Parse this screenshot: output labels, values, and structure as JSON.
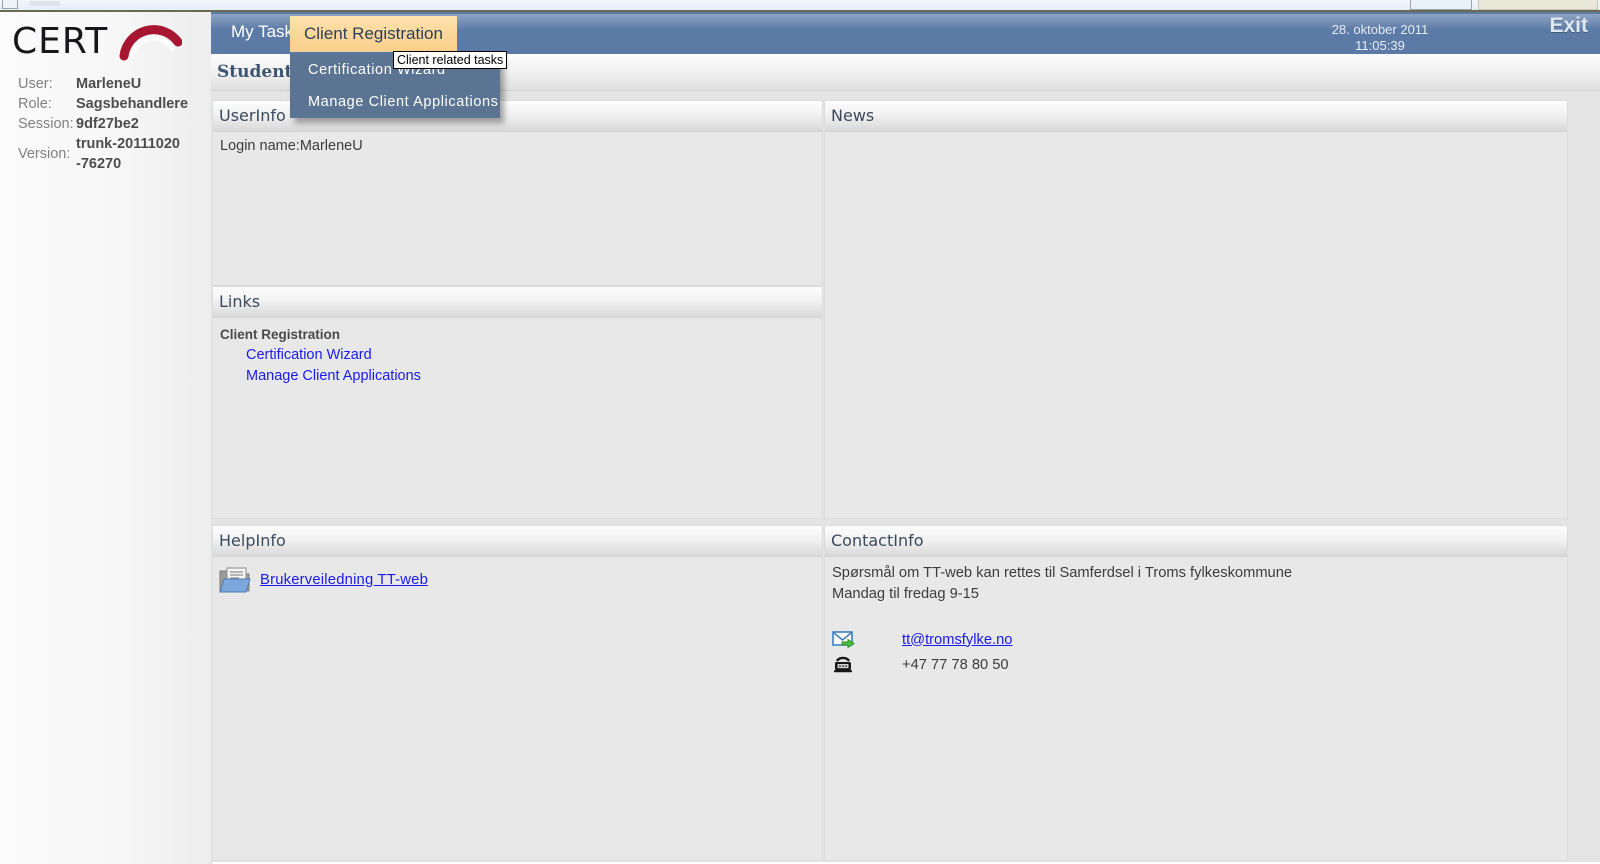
{
  "app": {
    "logo_text": "CERT",
    "page_title": "Student P"
  },
  "sidebar": {
    "rows": [
      {
        "label": "User:",
        "value": "MarleneU"
      },
      {
        "label": "Role:",
        "value": "Sagsbehandlere"
      },
      {
        "label": "Session:",
        "value": "9df27be2"
      },
      {
        "label": "Version:",
        "value": "trunk-20111020\n-76270"
      }
    ]
  },
  "topbar": {
    "tabs": [
      {
        "label": "My Tasks",
        "active": false
      },
      {
        "label": "Client Registration",
        "active": true
      }
    ],
    "date": "28. oktober 2011",
    "time": "11:05:39",
    "exit_label": "Exit"
  },
  "dropdown": {
    "tooltip": "Client related tasks",
    "items": [
      {
        "label": "Certification Wizard"
      },
      {
        "label": "Manage Client Applications"
      }
    ]
  },
  "panels": {
    "userinfo": {
      "title": "UserInfo",
      "login_label": "Login name:",
      "login_value": "MarleneU"
    },
    "links": {
      "title": "Links",
      "group_title": "Client Registration",
      "items": [
        {
          "label": "Certification Wizard"
        },
        {
          "label": "Manage Client Applications"
        }
      ]
    },
    "helpinfo": {
      "title": "HelpInfo",
      "icon": "folder-document-icon",
      "link_label": "Brukerveiledning TT-web"
    },
    "news": {
      "title": "News",
      "body": ""
    },
    "contactinfo": {
      "title": "ContactInfo",
      "line1": "Spørsmål om TT-web kan rettes til Samferdsel i Troms fylkeskommune",
      "line2": "Mandag til fredag 9-15",
      "email": "tt@tromsfylke.no",
      "phone": "+47 77 78 80 50",
      "email_icon": "envelope-icon",
      "phone_icon": "telephone-icon"
    }
  },
  "colors": {
    "nav_blue": "#5b7aa6",
    "active_tab_orange": "#fbd79a",
    "dropdown_blue": "#5b7493",
    "link_blue": "#1a1af0",
    "logo_red": "#a61630",
    "panel_gray": "#e8e8e8"
  }
}
